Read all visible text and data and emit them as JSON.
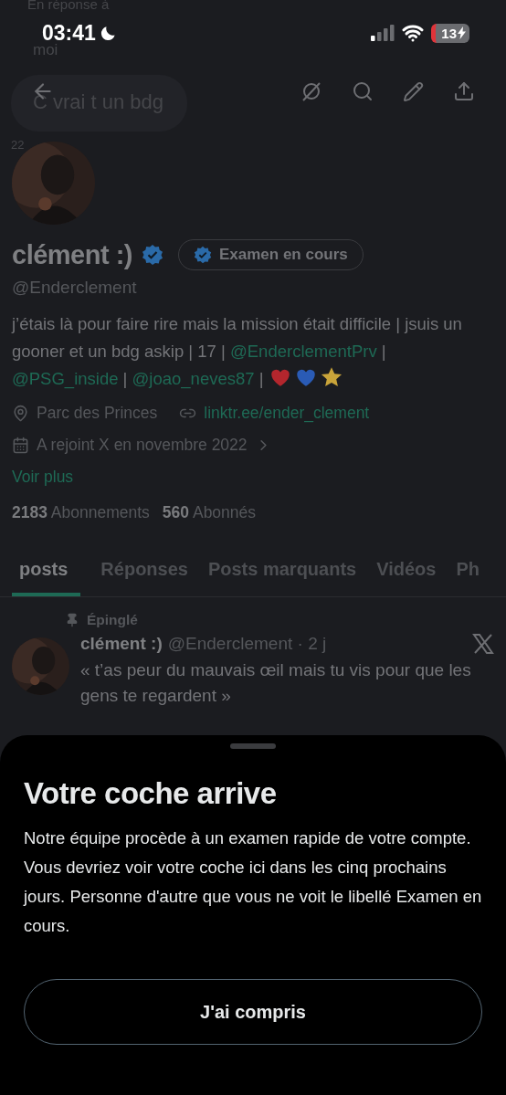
{
  "ghost": {
    "reply_label": "En réponse à",
    "sender": "moi",
    "message": "C vrai t un bdg",
    "date": "22"
  },
  "status_bar": {
    "time": "03:41",
    "battery": "13"
  },
  "profile": {
    "name": "clément :)",
    "verified": true,
    "review_badge": "Examen en cours",
    "handle": "@Enderclement",
    "bio": [
      {
        "kind": "text",
        "text": "j’étais là pour faire rire mais la mission était difficile | jsuis un gooner et un bdg askip | 17 | "
      },
      {
        "kind": "link",
        "text": "@EnderclementPrv"
      },
      {
        "kind": "text",
        "text": " | "
      },
      {
        "kind": "link",
        "text": "@PSG_inside"
      },
      {
        "kind": "text",
        "text": " | "
      },
      {
        "kind": "link",
        "text": "@joao_neves87"
      },
      {
        "kind": "text",
        "text": " | "
      },
      {
        "kind": "heart",
        "color": "#b3262d"
      },
      {
        "kind": "heart",
        "color": "#2a5bb5"
      },
      {
        "kind": "star",
        "color": "#c9a43a"
      }
    ],
    "location": "Parc des Princes",
    "website": "linktr.ee/ender_clement",
    "joined": "A rejoint X en novembre 2022",
    "more": "Voir plus",
    "following_count": "2183",
    "following_label": "Abonnements",
    "followers_count": "560",
    "followers_label": "Abonnés"
  },
  "tabs": [
    {
      "label": "posts",
      "selected": true
    },
    {
      "label": "Réponses",
      "selected": false
    },
    {
      "label": "Posts marquants",
      "selected": false
    },
    {
      "label": "Vidéos",
      "selected": false
    },
    {
      "label": "Ph",
      "selected": false
    }
  ],
  "pinned_post": {
    "pinned_label": "Épinglé",
    "name": "clément :)",
    "handle": "@Enderclement",
    "time": "· 2 j",
    "text": "« t’as peur du mauvais œil mais tu vis pour que les gens te regardent »"
  },
  "sheet": {
    "title": "Votre coche arrive",
    "body": "Notre équipe procède à un examen rapide de votre compte. Vous devriez voir votre coche ici dans les cinq prochains jours. Personne d'autre que vous ne voit le libellé Examen en cours.",
    "button": "J'ai compris"
  }
}
